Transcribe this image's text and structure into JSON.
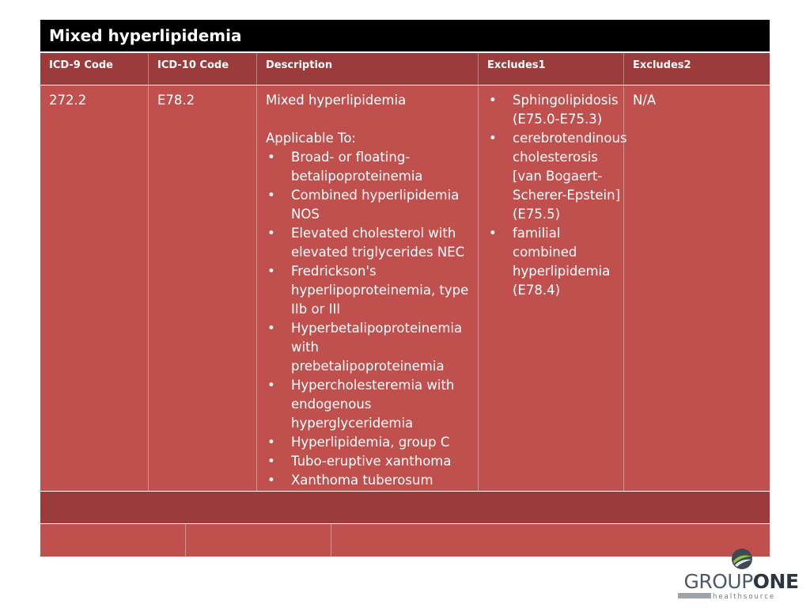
{
  "title": "Mixed hyperlipidemia",
  "headers": [
    "ICD-9 Code",
    "ICD-10 Code",
    "Description",
    "Excludes1",
    "Excludes2"
  ],
  "row": {
    "icd9": "272.2",
    "icd10": "E78.2",
    "description_title": "Mixed hyperlipidemia",
    "applicable_label": "Applicable To:",
    "applicable_items": [
      "Broad- or floating-betalipoproteinemia",
      "Combined hyperlipidemia NOS",
      "Elevated cholesterol with elevated triglycerides NEC",
      "Fredrickson's hyperlipoproteinemia, type IIb or III",
      "Hyperbetalipoproteinemia with prebetalipoproteinemia",
      "Hypercholesteremia with endogenous hyperglyceridemia",
      "Hyperlipidemia, group C",
      "Tubo-eruptive xanthoma",
      "Xanthoma tuberosum"
    ],
    "excludes1": [
      "Sphingolipidosis (E75.0-E75.3)",
      "cerebrotendinous cholesterosis [van Bogaert-Scherer-Epstein] (E75.5)",
      "familial combined hyperlipidemia (E78.4)"
    ],
    "excludes2": "N/A"
  },
  "logo": {
    "group": "GROUP",
    "one": "ONE",
    "sub": "healthsource"
  },
  "colors": {
    "title_bg": "#000000",
    "header_bg": "#9b3b3b",
    "cell_bg": "#c0504d"
  }
}
